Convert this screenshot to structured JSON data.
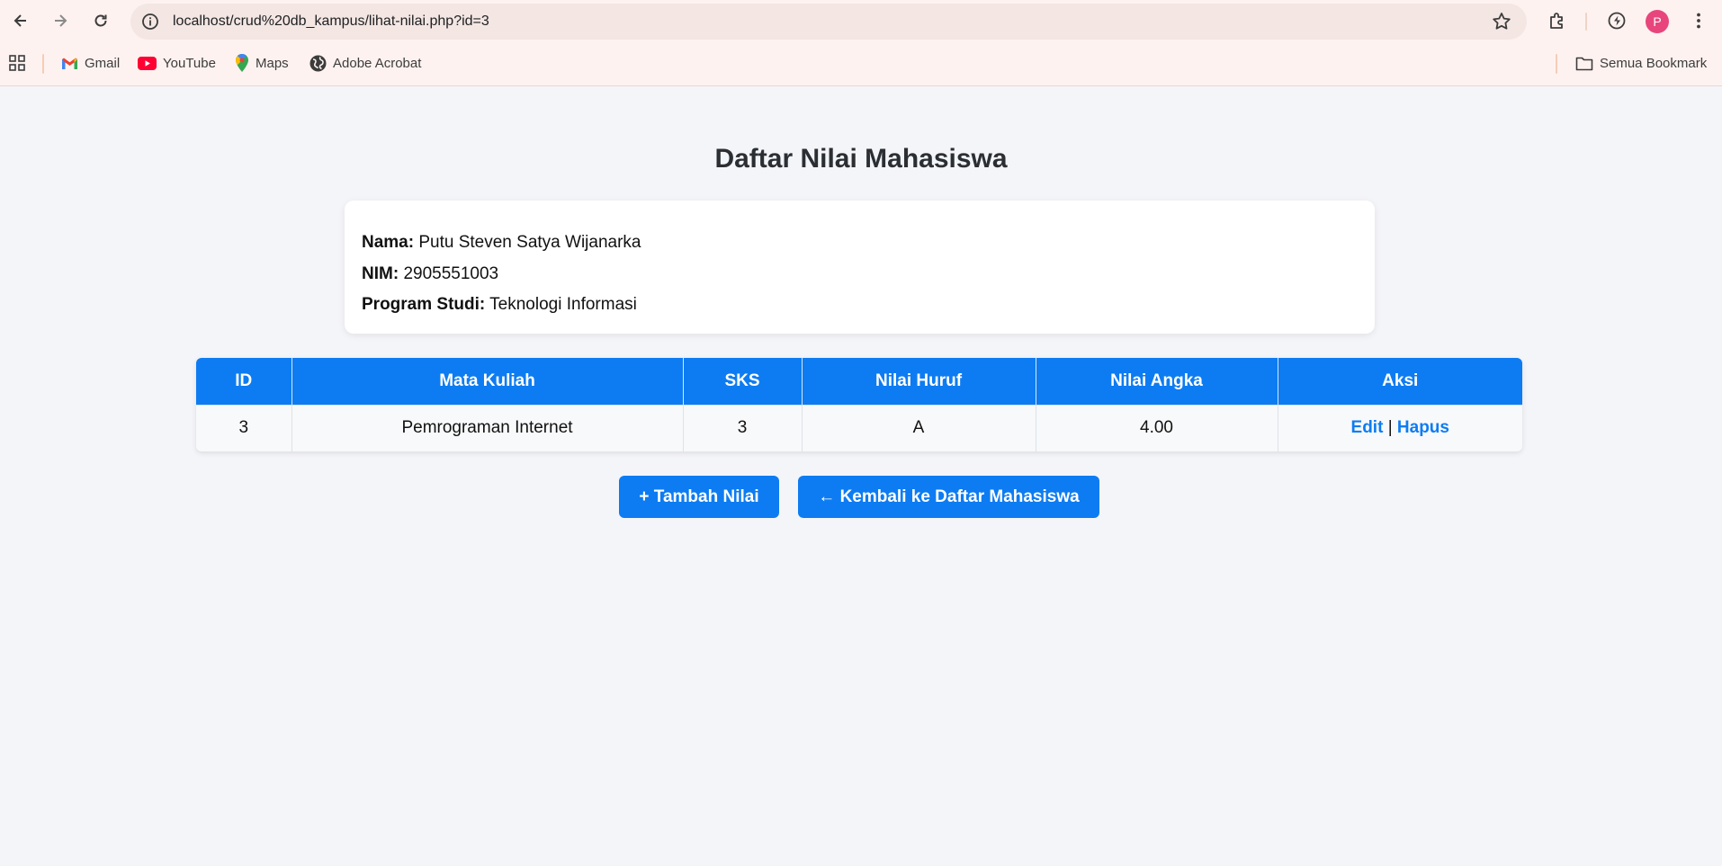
{
  "browser": {
    "url": "localhost/crud%20db_kampus/lihat-nilai.php?id=3",
    "profile_initial": "P",
    "bookmarks": [
      {
        "label": "Gmail",
        "icon": "gmail-icon"
      },
      {
        "label": "YouTube",
        "icon": "youtube-icon"
      },
      {
        "label": "Maps",
        "icon": "maps-icon"
      },
      {
        "label": "Adobe Acrobat",
        "icon": "globe-icon"
      }
    ],
    "all_bookmarks_label": "Semua Bookmark"
  },
  "page": {
    "title": "Daftar Nilai Mahasiswa",
    "student": {
      "name_label": "Nama:",
      "name": "Putu Steven Satya Wijanarka",
      "nim_label": "NIM:",
      "nim": "2905551003",
      "prodi_label": "Program Studi:",
      "prodi": "Teknologi Informasi"
    },
    "table": {
      "headers": [
        "ID",
        "Mata Kuliah",
        "SKS",
        "Nilai Huruf",
        "Nilai Angka",
        "Aksi"
      ],
      "rows": [
        {
          "id": "3",
          "mata_kuliah": "Pemrograman Internet",
          "sks": "3",
          "nilai_huruf": "A",
          "nilai_angka": "4.00",
          "edit": "Edit",
          "sep": "|",
          "hapus": "Hapus"
        }
      ]
    },
    "buttons": {
      "add": "+ Tambah Nilai",
      "back": "← Kembali ke Daftar Mahasiswa"
    }
  },
  "colors": {
    "primary": "#0d7cf2",
    "page_bg": "#f4f5f9",
    "chrome_bg": "#fdf2f0"
  }
}
